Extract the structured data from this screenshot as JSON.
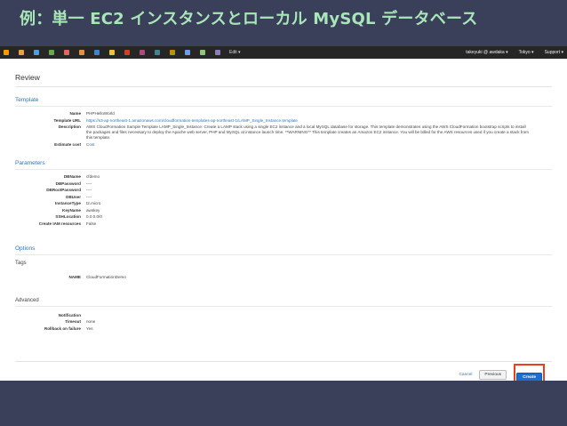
{
  "slide": {
    "title": "例：単一 EC2 インスタンスとローカル MySQL データベース"
  },
  "topnav": {
    "services": [
      {
        "name": "aws-logo-icon",
        "color": "#f90"
      },
      {
        "name": "service-icon-1",
        "color": "#e7a33e"
      },
      {
        "name": "service-icon-2",
        "color": "#5a9bd5"
      },
      {
        "name": "service-icon-3",
        "color": "#6aa84f"
      },
      {
        "name": "service-icon-4",
        "color": "#e06666"
      },
      {
        "name": "service-icon-5",
        "color": "#e69138"
      },
      {
        "name": "service-icon-6",
        "color": "#3d85c6"
      },
      {
        "name": "service-icon-7",
        "color": "#f1c232"
      },
      {
        "name": "service-icon-8",
        "color": "#cc4125"
      },
      {
        "name": "service-icon-9",
        "color": "#a64d79"
      },
      {
        "name": "service-icon-10",
        "color": "#45818e"
      },
      {
        "name": "service-icon-11",
        "color": "#bf9000"
      },
      {
        "name": "service-icon-12",
        "color": "#6d9eeb"
      },
      {
        "name": "service-icon-13",
        "color": "#93c47d"
      },
      {
        "name": "service-icon-14",
        "color": "#8e7cc3"
      }
    ],
    "edit_label": "Edit ▾",
    "user_label": "takeyuki @ awdaka ▾",
    "region_label": "Tokyo ▾",
    "support_label": "Support ▾"
  },
  "page": {
    "heading": "Review",
    "template": {
      "title": "Template",
      "rows": [
        {
          "k": "Name",
          "v": "PHPHelloWorld"
        },
        {
          "k": "Template URL",
          "v": "https://s3-ap-northeast-1.amazonaws.com/cloudformation-templates-ap-northeast-1/LAMP_Single_Instance.template"
        },
        {
          "k": "Description",
          "v": "AWS CloudFormation Sample Template LAMP_Single_Instance: Create a LAMP stack using a single EC2 instance and a local MySQL database for storage. This template demonstrates using the AWS CloudFormation bootstrap scripts to install the packages and files necessary to deploy the Apache web server, PHP and MySQL at instance launch time. **WARNING** This template creates an Amazon EC2 instance. You will be billed for the AWS resources used if you create a stack from this template."
        },
        {
          "k": "Estimate cost",
          "v": "Cost"
        }
      ]
    },
    "parameters": {
      "title": "Parameters",
      "rows": [
        {
          "k": "DBName",
          "v": "cfdemo"
        },
        {
          "k": "DBPassword",
          "v": "----"
        },
        {
          "k": "DBRootPassword",
          "v": "----"
        },
        {
          "k": "DBUser",
          "v": "----"
        },
        {
          "k": "InstanceType",
          "v": "t2.micro"
        },
        {
          "k": "KeyName",
          "v": "awskey"
        },
        {
          "k": "SSHLocation",
          "v": "0.0.0.0/0"
        },
        {
          "k": "Create IAM resources",
          "v": "False"
        }
      ]
    },
    "options": {
      "title": "Options",
      "tags_title": "Tags",
      "tags": [
        {
          "k": "NAME",
          "v": "CloudFormationDemo"
        }
      ],
      "advanced_title": "Advanced",
      "advanced": [
        {
          "k": "Notification",
          "v": ""
        },
        {
          "k": "Timeout",
          "v": "none"
        },
        {
          "k": "Rollback on failure",
          "v": "Yes"
        }
      ]
    },
    "actions": {
      "cancel": "Cancel",
      "previous": "Previous",
      "create": "Create"
    }
  }
}
